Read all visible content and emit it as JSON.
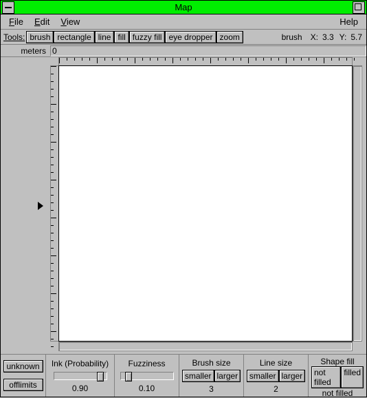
{
  "titlebar": {
    "title": "Map"
  },
  "menubar": {
    "file": "File",
    "edit": "Edit",
    "view": "View",
    "help": "Help"
  },
  "toolbar": {
    "label": "Tools:",
    "brush": "brush",
    "rectangle": "rectangle",
    "line": "line",
    "fill": "fill",
    "fuzzy_fill": "fuzzy fill",
    "eye_dropper": "eye dropper",
    "zoom": "zoom",
    "current_tool": "brush",
    "x_label": "X:",
    "x_value": "3.3",
    "y_label": "Y:",
    "y_value": "5.7"
  },
  "ruler": {
    "unit": "meters",
    "origin": "0"
  },
  "bottom": {
    "unknown": "unknown",
    "offlimits": "offlimits",
    "ink": {
      "label": "Ink (Probability)",
      "value": "0.90"
    },
    "fuzz": {
      "label": "Fuzziness",
      "value": "0.10"
    },
    "brush": {
      "label": "Brush size",
      "smaller": "smaller",
      "larger": "larger",
      "value": "3"
    },
    "line": {
      "label": "Line size",
      "smaller": "smaller",
      "larger": "larger",
      "value": "2"
    },
    "shape": {
      "label": "Shape fill",
      "not_filled": "not filled",
      "filled": "filled",
      "value": "not filled"
    }
  }
}
